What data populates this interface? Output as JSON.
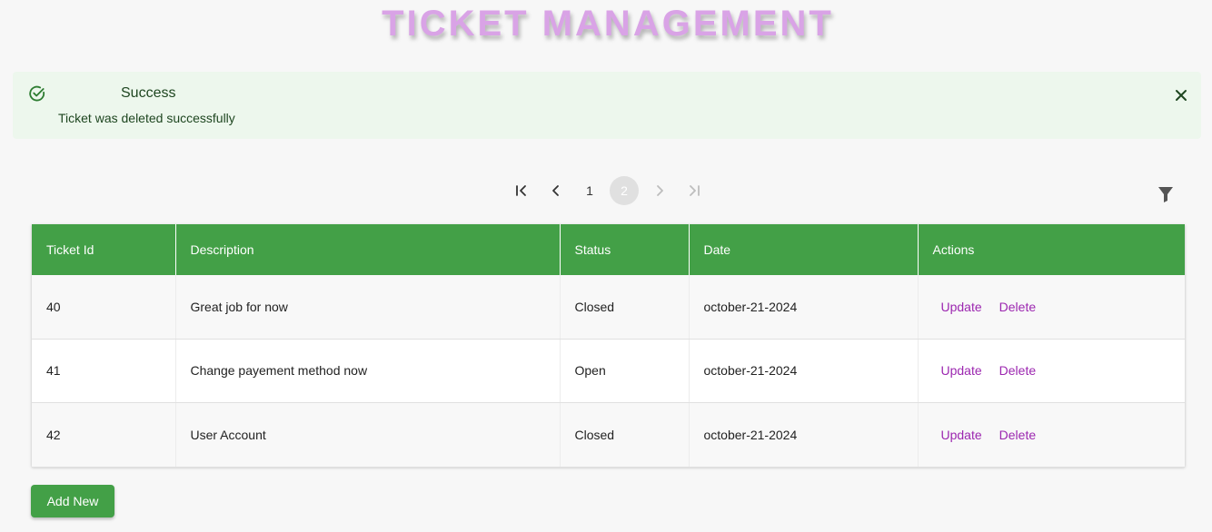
{
  "header": {
    "title": "TICKET MANAGEMENT"
  },
  "alert": {
    "title": "Success",
    "message": "Ticket was deleted successfully",
    "icon": "check-circle-icon",
    "close_icon": "close-icon",
    "color": "#1e4620",
    "background": "#edf7ed"
  },
  "pagination": {
    "first_icon": "first-page-icon",
    "prev_icon": "chevron-left-icon",
    "pages": [
      "1",
      "2"
    ],
    "current_page": "2",
    "next_icon": "chevron-right-icon",
    "last_icon": "last-page-icon"
  },
  "filter": {
    "icon": "filter-icon"
  },
  "table": {
    "header_color": "#43a047",
    "columns": [
      "Ticket Id",
      "Description",
      "Status",
      "Date",
      "Actions"
    ],
    "rows": [
      {
        "id": "40",
        "description": "Great job for now",
        "status": "Closed",
        "date": "october-21-2024",
        "update": "Update",
        "delete": "Delete"
      },
      {
        "id": "41",
        "description": "Change payement method now",
        "status": "Open",
        "date": "october-21-2024",
        "update": "Update",
        "delete": "Delete"
      },
      {
        "id": "42",
        "description": "User Account",
        "status": "Closed",
        "date": "october-21-2024",
        "update": "Update",
        "delete": "Delete"
      }
    ]
  },
  "footer": {
    "add_label": "Add New"
  }
}
